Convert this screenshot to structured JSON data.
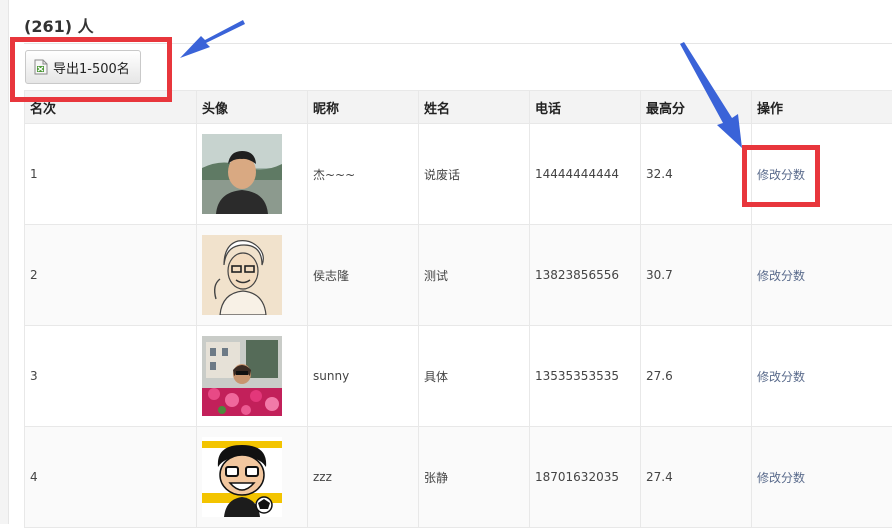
{
  "header": {
    "count_text": "(261) 人"
  },
  "toolbar": {
    "export_label": "导出1-500名",
    "export_icon": "excel-export-icon"
  },
  "table": {
    "columns": [
      "名次",
      "头像",
      "昵称",
      "姓名",
      "电话",
      "最高分",
      "操作"
    ],
    "rows": [
      {
        "rank": "1",
        "nickname": "杰~~~",
        "name": "说废话",
        "phone": "14444444444",
        "score": "32.4",
        "action": "修改分数"
      },
      {
        "rank": "2",
        "nickname": "侯志隆",
        "name": "测试",
        "phone": "13823856556",
        "score": "30.7",
        "action": "修改分数"
      },
      {
        "rank": "3",
        "nickname": "sunny",
        "name": "具体",
        "phone": "13535353535",
        "score": "27.6",
        "action": "修改分数"
      },
      {
        "rank": "4",
        "nickname": "zzz",
        "name": "张静",
        "phone": "18701632035",
        "score": "27.4",
        "action": "修改分数"
      }
    ]
  },
  "colors": {
    "annotation_red": "#e8363c",
    "annotation_arrow_blue": "#3a63d8",
    "link": "#5a6b8c"
  }
}
